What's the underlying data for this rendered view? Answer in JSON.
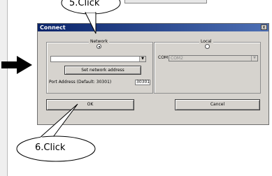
{
  "dialog": {
    "title": "Connect",
    "close_glyph": "x",
    "network_group_label": "Network",
    "local_group_label": "Local",
    "network_radio_checked": true,
    "local_radio_checked": false,
    "network_combo_value": "",
    "set_network_address_label": "Set network address",
    "port_label": "Port Address (Default: 30301)",
    "port_value": "30301",
    "com_label": "COM",
    "com_value": "COM2",
    "ok_label": "OK",
    "cancel_label": "Cancel"
  },
  "callouts": [
    {
      "text": "5.Click"
    },
    {
      "text": "6.Click"
    }
  ],
  "icons": {
    "left_arrow": "arrow-right-icon",
    "dropdown": "chevron-down-icon",
    "close": "close-icon"
  },
  "colors": {
    "titlebar": "#0a246a",
    "dialog_bg": "#d6d3ce"
  }
}
